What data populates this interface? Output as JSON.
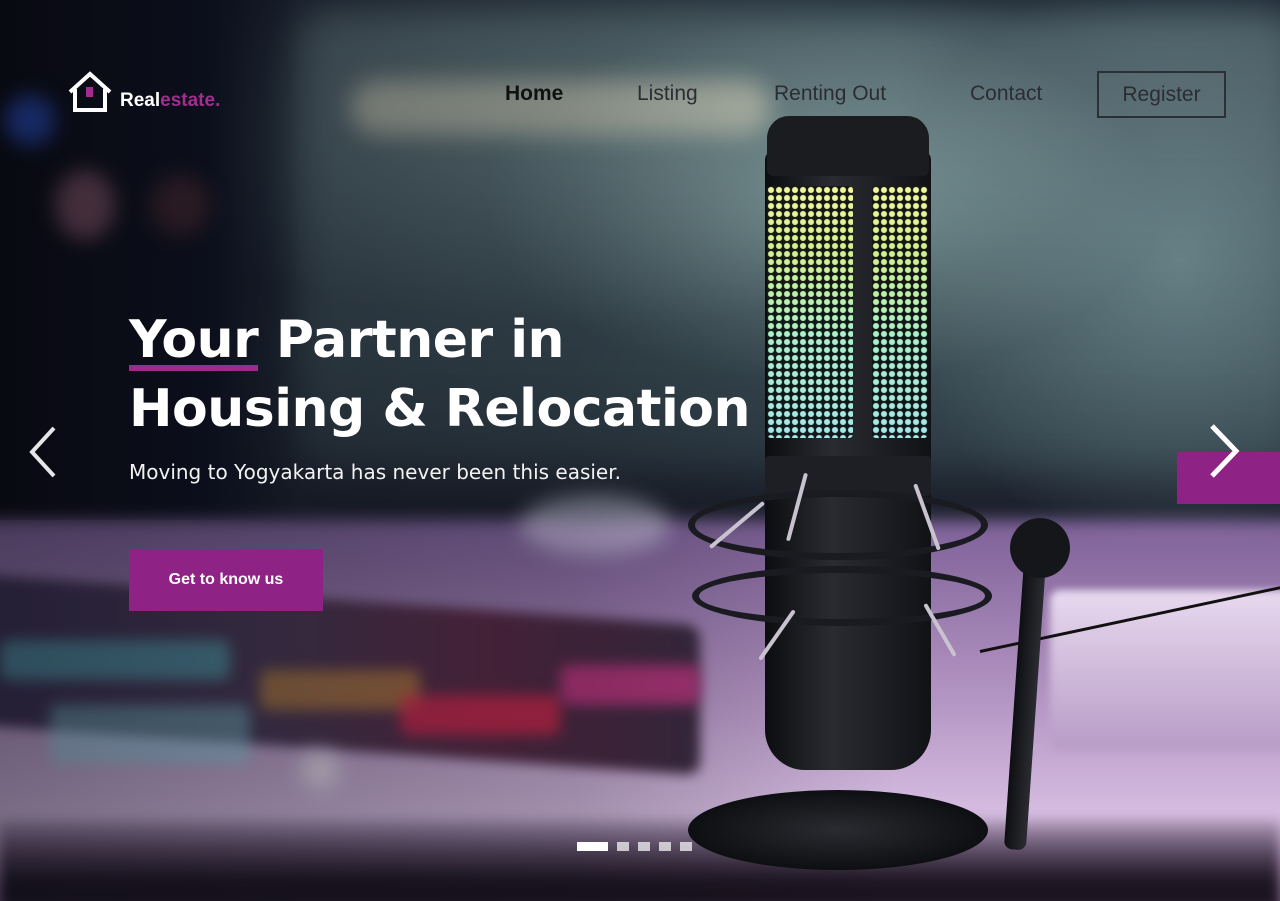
{
  "brand": {
    "name_primary": "Real",
    "name_accent": "estate.",
    "accent_color": "#8f2385",
    "logo_icon": "house-icon"
  },
  "nav": {
    "links": [
      {
        "label": "Home",
        "active": true
      },
      {
        "label": "Listing",
        "active": false
      },
      {
        "label": "Renting Out",
        "active": false
      },
      {
        "label": "Contact",
        "active": false
      }
    ],
    "register_label": "Register"
  },
  "hero": {
    "headline_underlined": "Your",
    "headline_rest_line1": " Partner in",
    "headline_line2": "Housing & Relocation",
    "subline": "Moving to Yogyakarta has never been this easier.",
    "cta_label": "Get to know us",
    "prev_icon": "chevron-left-icon",
    "next_icon": "chevron-right-icon"
  },
  "carousel": {
    "slide_count": 5,
    "active_index": 0
  }
}
